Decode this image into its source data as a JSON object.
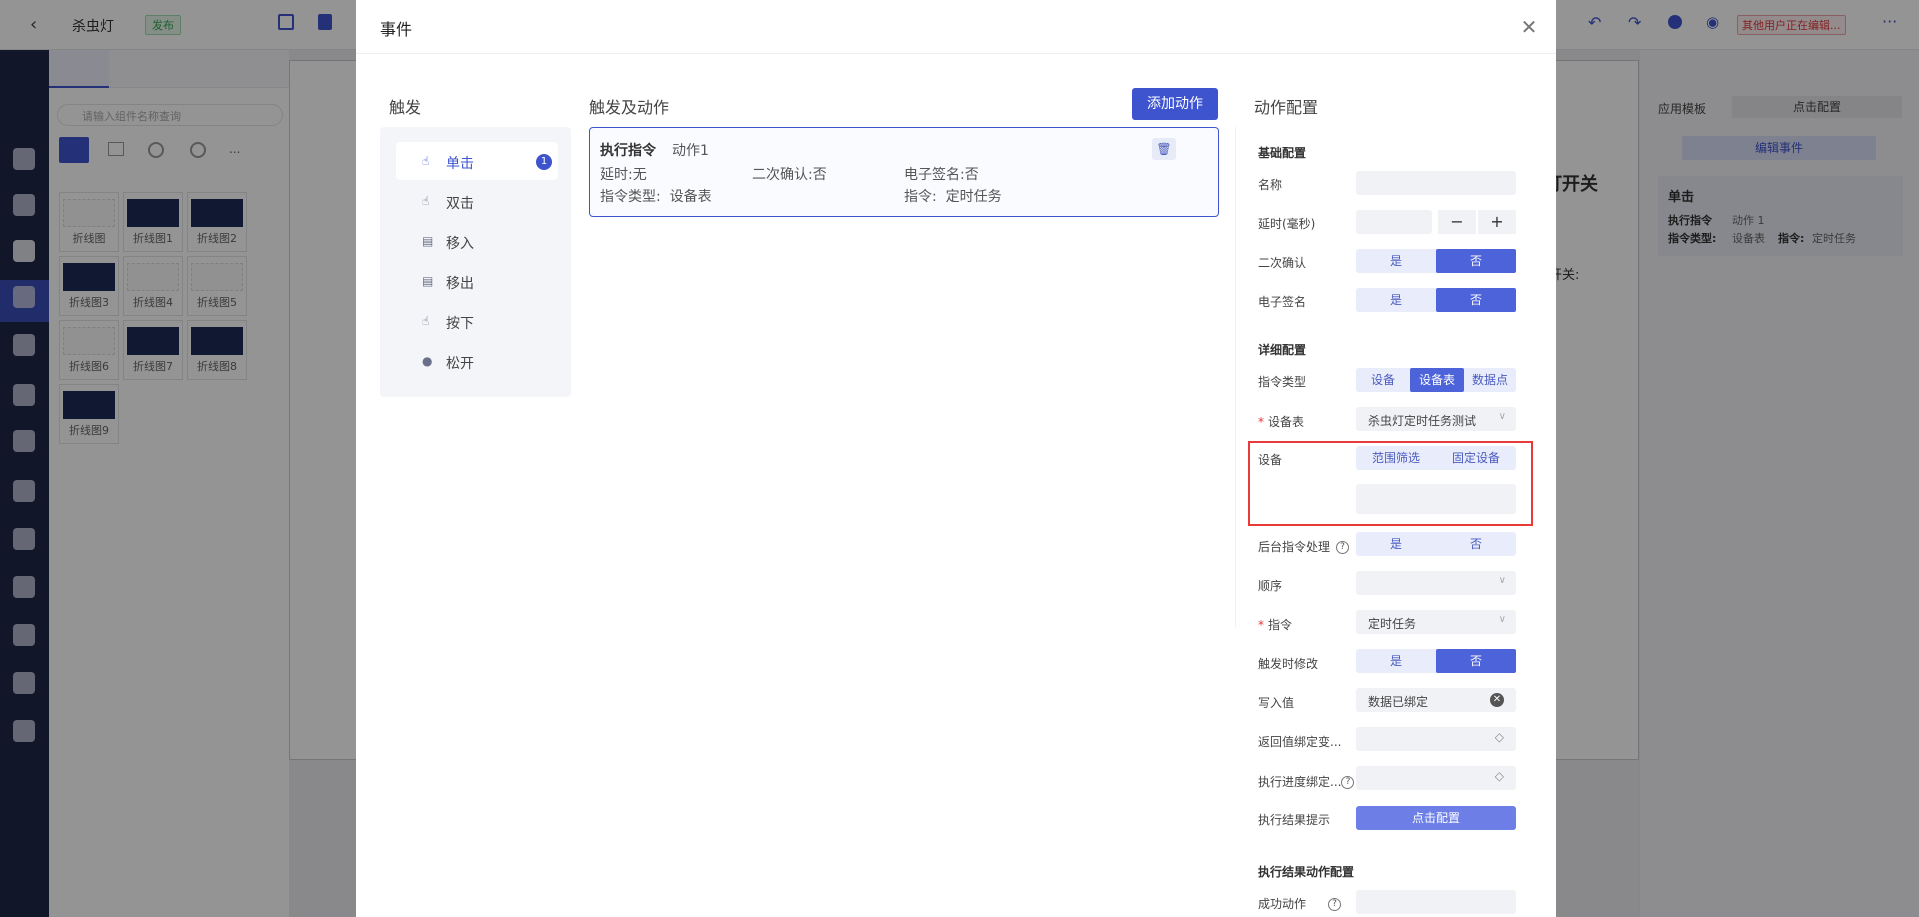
{
  "editor": {
    "back_icon": "chevron-left-icon",
    "app_name": "杀虫灯",
    "publish_badge": "发布",
    "other_user_editing": "其他用户正在编辑...",
    "more": "···",
    "component_search_placeholder": "请输入组件名称查询",
    "more_categories": "...",
    "thumbnails": [
      "折线图",
      "折线图1",
      "折线图2",
      "折线图3",
      "折线图4",
      "折线图5",
      "折线图6",
      "折线图7",
      "折线图8",
      "折线图9"
    ],
    "canvas_fragment_1": "打开关",
    "canvas_fragment_2": "开关:",
    "right_panel": {
      "tab_template": "应用模板",
      "tab_click_config": "点击配置",
      "edit_event_button": "编辑事件",
      "event_title": "单击",
      "event_line1_a": "执行指令",
      "event_line1_b": "动作 1",
      "event_line2_a": "指令类型:",
      "event_line2_b": "设备表",
      "event_line2_c": "指令:",
      "event_line2_d": "定时任务"
    },
    "colors": {
      "accent": "#3e54cf",
      "nav": "#1f2747",
      "publish_green": "#2fa84f",
      "warning_red": "#e3373b"
    }
  },
  "dialog": {
    "title": "事件",
    "close_icon": "close-icon",
    "trigger_title": "触发",
    "trigger_action_title": "触发及动作",
    "action_config_title": "动作配置",
    "add_action_button": "添加动作",
    "triggers": [
      {
        "label": "单击",
        "icon": "pointer-icon",
        "badge": "1",
        "active": true
      },
      {
        "label": "双击",
        "icon": "pointer-icon"
      },
      {
        "label": "移入",
        "icon": "enter-icon"
      },
      {
        "label": "移出",
        "icon": "exit-icon"
      },
      {
        "label": "按下",
        "icon": "pointer-icon"
      },
      {
        "label": "松开",
        "icon": "release-icon"
      }
    ],
    "action_card": {
      "type": "执行指令",
      "name": "动作1",
      "delay": "延时:无",
      "confirm": "二次确认:否",
      "esign": "电子签名:否",
      "cmd_type": "指令类型:  设备表",
      "cmd": "指令:  定时任务",
      "delete_icon": "trash-icon"
    },
    "config": {
      "basic_group": "基础配置",
      "name_label": "名称",
      "name_value": "",
      "delay_label": "延时(毫秒)",
      "delay_value": "",
      "minus": "−",
      "plus": "+",
      "second_confirm_label": "二次确认",
      "esign_label": "电子签名",
      "yes": "是",
      "no": "否",
      "detail_group": "详细配置",
      "cmd_type_label": "指令类型",
      "cmd_type_options": [
        "设备",
        "设备表",
        "数据点"
      ],
      "cmd_type_selected": "设备表",
      "device_table_label": "设备表",
      "device_table_value": "杀虫灯定时任务测试",
      "device_label": "设备",
      "device_mode_options": [
        "范围筛选",
        "固定设备"
      ],
      "device_value": "",
      "backend_label": "后台指令处理",
      "order_label": "顺序",
      "order_value": "",
      "cmd_label": "指令",
      "cmd_value": "定时任务",
      "modify_on_trigger_label": "触发时修改",
      "write_value_label": "写入值",
      "write_value_value": "数据已绑定",
      "return_bind_label": "返回值绑定变...",
      "progress_bind_label": "执行进度绑定...",
      "result_tip_label": "执行结果提示",
      "result_tip_button": "点击配置",
      "result_action_group": "执行结果动作配置",
      "success_action_label": "成功动作",
      "required_mark": "*",
      "help_mark": "?"
    }
  }
}
